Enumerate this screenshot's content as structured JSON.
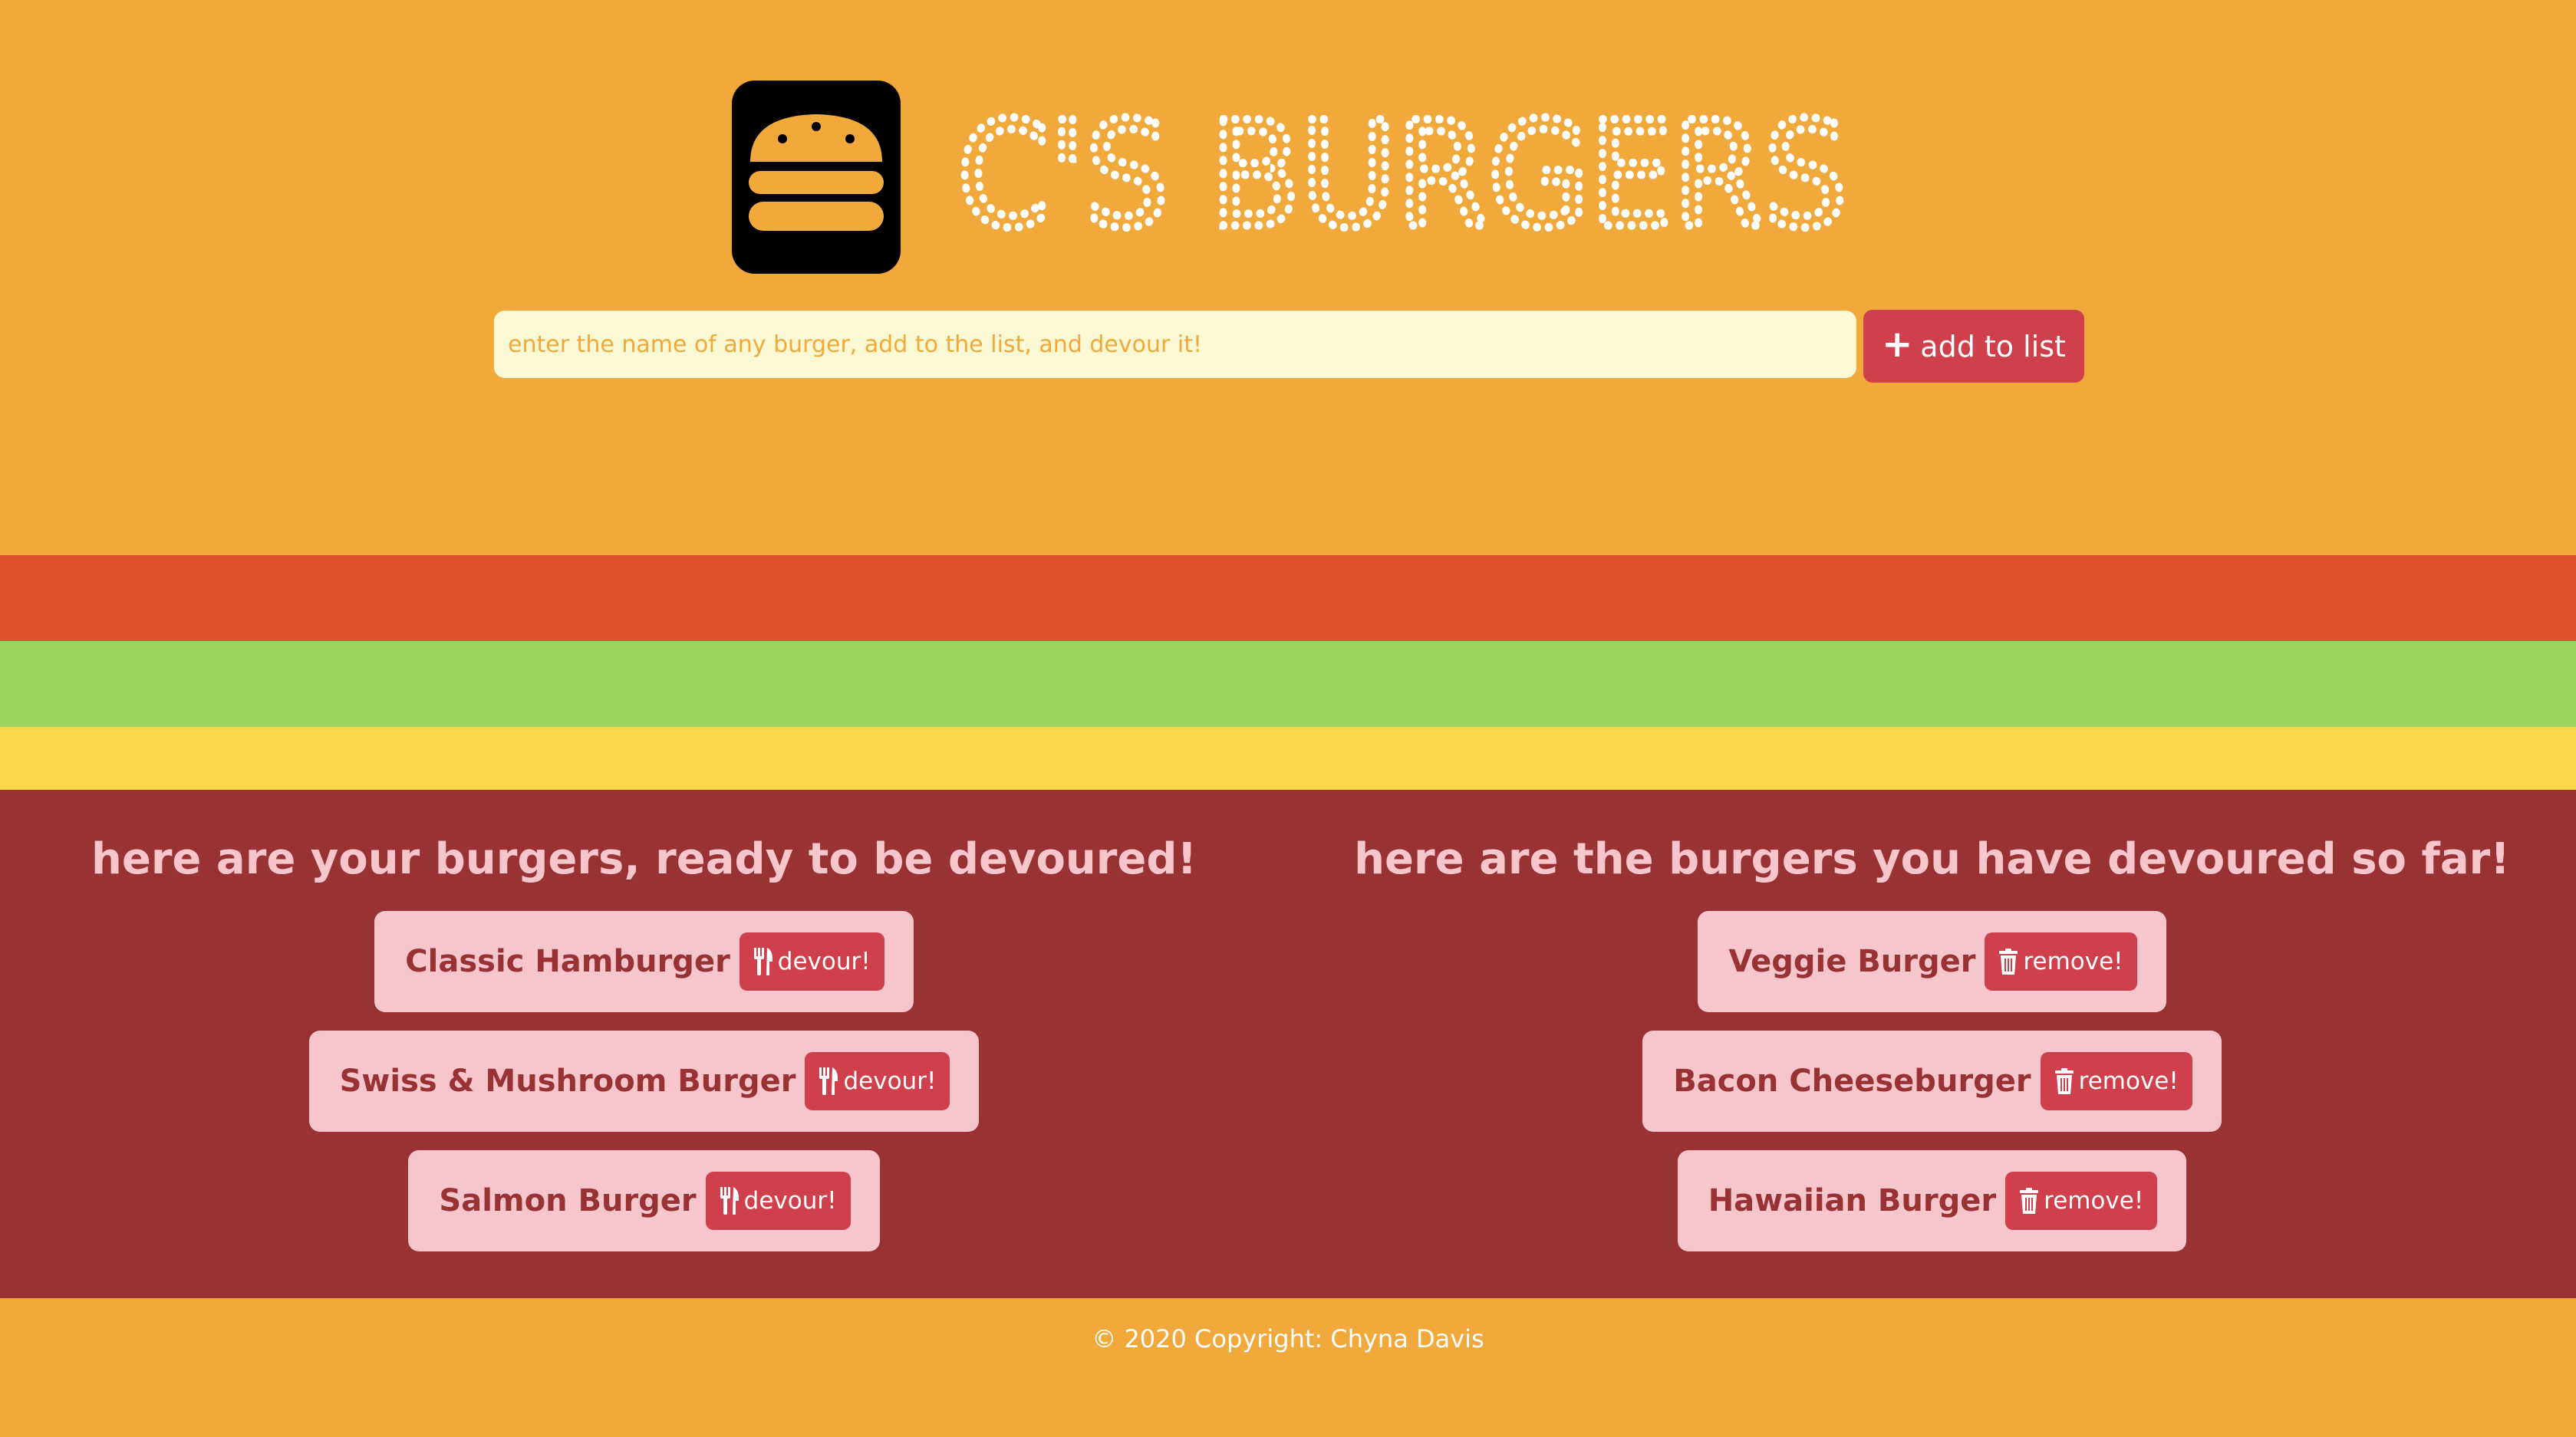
{
  "brand": {
    "title": "C'S BURGERS",
    "logo_icon": "burger-icon",
    "colors": {
      "background": "#f2a93b",
      "tomato": "#df4f2c",
      "lettuce": "#9bd460",
      "cheese": "#f8d749",
      "patty": "#993232",
      "card": "#f7c6cd",
      "button": "#d0404c",
      "input": "#fbf9d3"
    }
  },
  "search": {
    "placeholder": "enter the name of any burger, add to the list, and devour it!",
    "value": "",
    "add_label": "add to list",
    "add_icon": "plus-icon"
  },
  "ready": {
    "heading": "here are your burgers, ready to be devoured!",
    "button_icon": "utensils-icon",
    "items": [
      {
        "name": "Classic Hamburger",
        "button": "devour!"
      },
      {
        "name": "Swiss & Mushroom Burger",
        "button": "devour!"
      },
      {
        "name": "Salmon Burger",
        "button": "devour!"
      }
    ]
  },
  "devoured": {
    "heading": "here are the burgers you have devoured so far!",
    "button_icon": "trash-icon",
    "items": [
      {
        "name": "Veggie Burger",
        "button": "remove!"
      },
      {
        "name": "Bacon Cheeseburger",
        "button": "remove!"
      },
      {
        "name": "Hawaiian Burger",
        "button": "remove!"
      }
    ]
  },
  "footer": {
    "text": "© 2020 Copyright: Chyna Davis"
  }
}
